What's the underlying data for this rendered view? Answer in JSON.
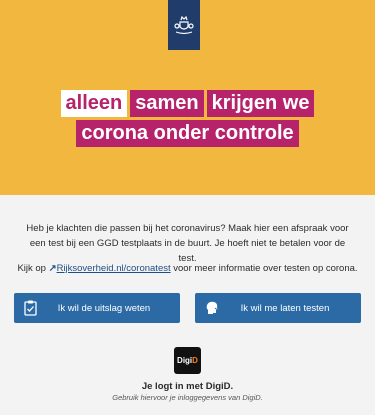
{
  "hero": {
    "slogan_line1": [
      "alleen",
      "samen",
      "krijgen we"
    ],
    "slogan_line2": [
      "corona onder controle"
    ],
    "colors": {
      "background": "#f2b73f",
      "tag": "#b6236b",
      "logo": "#1f3c6b"
    }
  },
  "content": {
    "intro": "Heb je klachten die passen bij het coronavirus? Maak hier een afspraak voor een test bij een GGD testplaats in de buurt. Je hoeft niet te betalen voor de test.",
    "more_prefix": "Kijk op",
    "link_text": "Rijksoverheid.nl/coronatest",
    "more_suffix": "voor meer informatie over testen op corona."
  },
  "buttons": {
    "result": {
      "label": "Ik wil de uitslag weten",
      "icon": "clipboard-check-icon"
    },
    "test": {
      "label": "Ik wil me laten testen",
      "icon": "swab-head-icon"
    }
  },
  "digid": {
    "logo_text": "DigiD",
    "login_title": "Je logt in met DigiD.",
    "login_hint": "Gebruik hiervoor je inloggegevens van DigiD."
  }
}
